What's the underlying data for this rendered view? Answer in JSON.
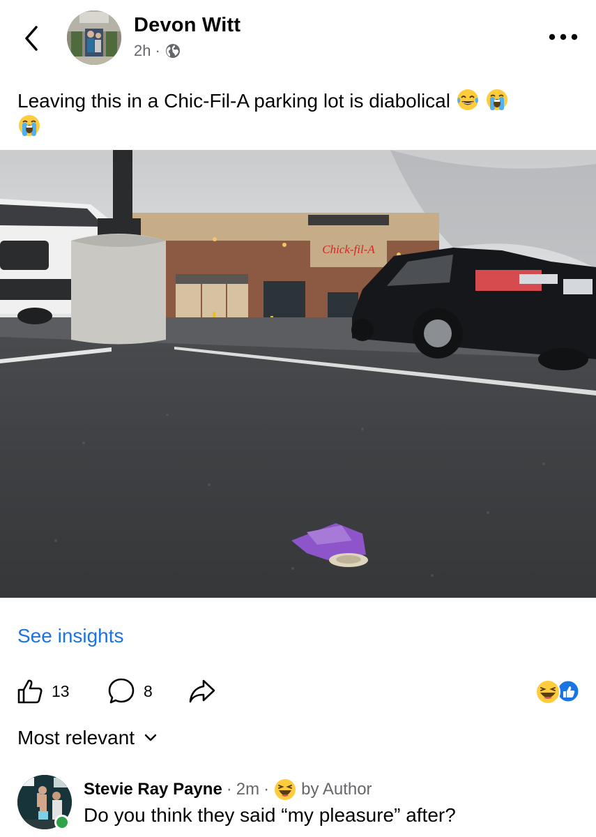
{
  "post": {
    "author": "Devon Witt",
    "time": "2h",
    "separator": "·",
    "audience_icon": "globe-icon",
    "caption": "Leaving this in a Chic-Fil-A parking lot is diabolical",
    "caption_emojis": [
      "laughing-tears-emoji",
      "crying-emoji",
      "crying-emoji"
    ],
    "photo_sign_text": "Chick-fil-A"
  },
  "insights": {
    "label": "See insights"
  },
  "actions": {
    "like_count": "13",
    "comment_count": "8",
    "reaction_icons": [
      "haha-reaction-icon",
      "like-reaction-icon"
    ]
  },
  "filter": {
    "label": "Most relevant"
  },
  "comment": {
    "author": "Stevie Ray Payne",
    "dot1": "·",
    "time": "2m",
    "dot2": "·",
    "badge": "by Author",
    "text": "Do you think they said “my pleasure” after?"
  },
  "colors": {
    "accent": "#1b74e4",
    "muted": "#65676b",
    "text": "#050505",
    "online": "#31a24c"
  }
}
